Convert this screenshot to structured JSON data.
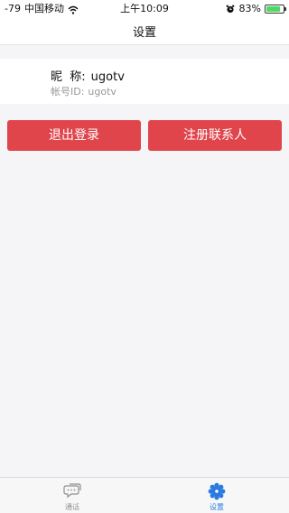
{
  "status_bar": {
    "signal": "-79",
    "carrier": "中国移动",
    "time": "上午10:09",
    "battery_percent_text": "83%",
    "battery_level": 0.83
  },
  "nav": {
    "title": "设置"
  },
  "profile": {
    "nickname_label": "昵  称:",
    "nickname_value": "ugotv",
    "account_label": "帐号ID:",
    "account_value": "ugotv"
  },
  "buttons": {
    "logout_label": "退出登录",
    "register_contact_label": "注册联系人"
  },
  "tab_bar": {
    "tabs": [
      {
        "label": "通话",
        "icon": "chat-bubble-icon",
        "active": false
      },
      {
        "label": "设置",
        "icon": "gear-icon",
        "active": true
      }
    ]
  },
  "colors": {
    "primary_button": "#e0454b",
    "active_tab": "#2a7be0",
    "inactive_tab": "#8e8e93",
    "battery": "#4cd964"
  }
}
